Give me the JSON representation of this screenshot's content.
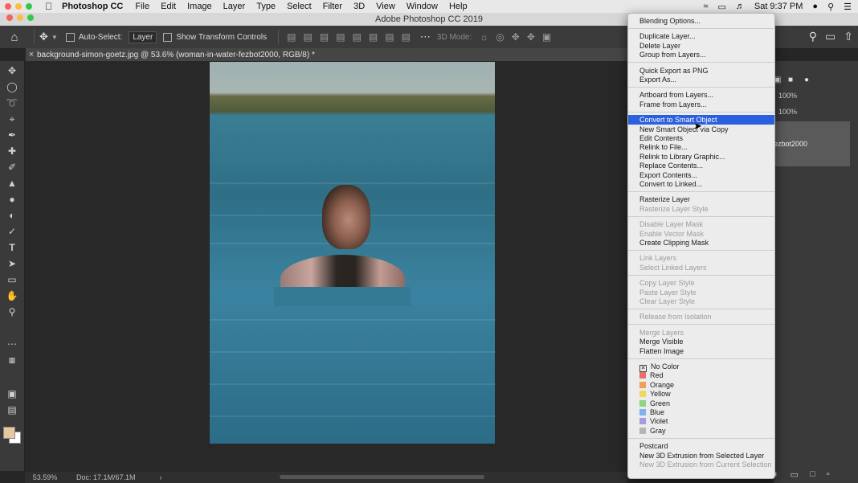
{
  "menubar": {
    "app": "Photoshop CC",
    "items": [
      "File",
      "Edit",
      "Image",
      "Layer",
      "Type",
      "Select",
      "Filter",
      "3D",
      "View",
      "Window",
      "Help"
    ],
    "window_title": "Adobe Photoshop CC 2019",
    "clock": "Sat 9:37 PM"
  },
  "options_bar": {
    "auto_select_label": "Auto-Select:",
    "auto_select_value": "Layer",
    "show_transform_label": "Show Transform Controls",
    "mode_3d_label": "3D Mode:"
  },
  "document": {
    "tab_title": "background-simon-goetz.jpg @ 53.6% (woman-in-water-fezbot2000, RGB/8) *"
  },
  "status_bar": {
    "zoom": "53.59%",
    "doc_info": "Doc: 17.1M/67.1M"
  },
  "right_panel": {
    "opacity_value": "100%",
    "fill_value": "100%",
    "layer_name_partial": "ezbot2000"
  },
  "context_menu": {
    "groups": [
      [
        {
          "label": "Blending Options..."
        }
      ],
      [
        {
          "label": "Duplicate Layer..."
        },
        {
          "label": "Delete Layer"
        },
        {
          "label": "Group from Layers..."
        }
      ],
      [
        {
          "label": "Quick Export as PNG"
        },
        {
          "label": "Export As..."
        }
      ],
      [
        {
          "label": "Artboard from Layers..."
        },
        {
          "label": "Frame from Layers..."
        }
      ],
      [
        {
          "label": "Convert to Smart Object",
          "highlighted": true
        },
        {
          "label": "New Smart Object via Copy"
        },
        {
          "label": "Edit Contents"
        },
        {
          "label": "Relink to File..."
        },
        {
          "label": "Relink to Library Graphic..."
        },
        {
          "label": "Replace Contents..."
        },
        {
          "label": "Export Contents..."
        },
        {
          "label": "Convert to Linked..."
        }
      ],
      [
        {
          "label": "Rasterize Layer"
        },
        {
          "label": "Rasterize Layer Style",
          "disabled": true
        }
      ],
      [
        {
          "label": "Disable Layer Mask",
          "disabled": true
        },
        {
          "label": "Enable Vector Mask",
          "disabled": true
        },
        {
          "label": "Create Clipping Mask"
        }
      ],
      [
        {
          "label": "Link Layers",
          "disabled": true
        },
        {
          "label": "Select Linked Layers",
          "disabled": true
        }
      ],
      [
        {
          "label": "Copy Layer Style",
          "disabled": true
        },
        {
          "label": "Paste Layer Style",
          "disabled": true
        },
        {
          "label": "Clear Layer Style",
          "disabled": true
        }
      ],
      [
        {
          "label": "Release from Isolation",
          "disabled": true
        }
      ],
      [
        {
          "label": "Merge Layers",
          "disabled": true
        },
        {
          "label": "Merge Visible"
        },
        {
          "label": "Flatten Image"
        }
      ],
      [
        {
          "label": "No Color",
          "swatch": "none"
        },
        {
          "label": "Red",
          "swatch": "#e8706a"
        },
        {
          "label": "Orange",
          "swatch": "#f0a155"
        },
        {
          "label": "Yellow",
          "swatch": "#eed663"
        },
        {
          "label": "Green",
          "swatch": "#93d27f"
        },
        {
          "label": "Blue",
          "swatch": "#7fb3ea"
        },
        {
          "label": "Violet",
          "swatch": "#a79ae6"
        },
        {
          "label": "Gray",
          "swatch": "#b5b5b5"
        }
      ],
      [
        {
          "label": "Postcard"
        },
        {
          "label": "New 3D Extrusion from Selected Layer"
        },
        {
          "label": "New 3D Extrusion from Current Selection",
          "disabled": true
        }
      ]
    ]
  },
  "colors": {
    "menu_highlight": "#2a5fde",
    "foreground_swatch": "#e5c89b",
    "background_swatch": "#ffffff"
  }
}
